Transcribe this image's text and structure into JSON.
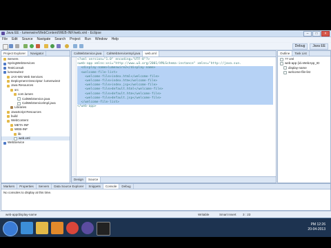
{
  "window": {
    "title": "Java EE - lumenwire/WebContent/WEB-INF/web.xml - Eclipse"
  },
  "menubar": [
    "File",
    "Edit",
    "Source",
    "Navigate",
    "Search",
    "Project",
    "Run",
    "Window",
    "Help"
  ],
  "perspectives": [
    "Debug",
    "Java EE"
  ],
  "left_panel": {
    "tabs": [
      "Project Explorer",
      "Navigator"
    ],
    "tree": [
      {
        "label": "Servers",
        "icon": "folder",
        "indent": 0
      },
      {
        "label": "SpringWebServices",
        "icon": "proj",
        "indent": 0
      },
      {
        "label": "TestConsult",
        "icon": "proj",
        "indent": 0
      },
      {
        "label": "lumenwire2",
        "icon": "proj",
        "indent": 0
      },
      {
        "label": "JAX-WS Web Services",
        "icon": "folder",
        "indent": 1
      },
      {
        "label": "Deployment Descriptor: lumenwire2",
        "icon": "folder",
        "indent": 1
      },
      {
        "label": "Java Resources",
        "icon": "folder",
        "indent": 1
      },
      {
        "label": "src",
        "icon": "folder",
        "indent": 2
      },
      {
        "label": "com.lumen",
        "icon": "folder",
        "indent": 3
      },
      {
        "label": "CalWebService.java",
        "icon": "file",
        "indent": 4
      },
      {
        "label": "CalWebServicelmpl.java",
        "icon": "file",
        "indent": 4
      },
      {
        "label": "Libraries",
        "icon": "jar",
        "indent": 2
      },
      {
        "label": "JavaScript Resources",
        "icon": "folder",
        "indent": 1
      },
      {
        "label": "build",
        "icon": "folder",
        "indent": 1
      },
      {
        "label": "WebContent",
        "icon": "folder",
        "indent": 1
      },
      {
        "label": "META-INF",
        "icon": "folder",
        "indent": 2
      },
      {
        "label": "WEB-INF",
        "icon": "folder",
        "indent": 2
      },
      {
        "label": "lib",
        "icon": "folder",
        "indent": 3
      },
      {
        "label": "web.xml",
        "icon": "file",
        "indent": 3
      },
      {
        "label": "WebService",
        "icon": "proj",
        "indent": 0
      }
    ]
  },
  "editor": {
    "tabs": [
      "CalWebService.java",
      "CalWebServiceImpl.java",
      "web.xml"
    ],
    "active_tab": "web.xml",
    "lines": [
      "<?xml version=\"1.0\" encoding=\"UTF-8\"?>",
      "<web-app xmlns:xsi=\"http://www.w3.org/2001/XMLSchema-instance\" xmlns=\"http://java.sun.",
      "  <display-name>lumenwire2</display-name>",
      "  <welcome-file-list>",
      "    <welcome-file>index.html</welcome-file>",
      "    <welcome-file>index.htm</welcome-file>",
      "    <welcome-file>index.jsp</welcome-file>",
      "    <welcome-file>default.html</welcome-file>",
      "    <welcome-file>default.htm</welcome-file>",
      "    <welcome-file>default.jsp</welcome-file>",
      "  </welcome-file-list>",
      "</web-app>"
    ],
    "bottom_tabs": [
      "Design",
      "Source"
    ]
  },
  "right_panel": {
    "tabs": [
      "Outline",
      "Task List"
    ],
    "tree": [
      {
        "label": "?? xml",
        "indent": 0
      },
      {
        "label": "web-app (id=WebApp_ID",
        "indent": 0
      },
      {
        "label": "display-name",
        "indent": 1
      },
      {
        "label": "welcome-file-list",
        "indent": 1
      }
    ]
  },
  "bottom_panel": {
    "tabs": [
      "Markers",
      "Properties",
      "Servers",
      "Data Source Explorer",
      "Snippets",
      "Console",
      "Debug"
    ],
    "message": "No consoles to display at this time."
  },
  "statusbar": {
    "path": "web-app/display-name",
    "writable": "Writable",
    "insert_mode": "Smart Insert",
    "position": "3 : 23"
  },
  "taskbar": {
    "time": "PM 12:26",
    "date": "20-04-2013"
  },
  "colors": {
    "selection": "#b6d2f5",
    "taskbar": "#1d3350"
  }
}
